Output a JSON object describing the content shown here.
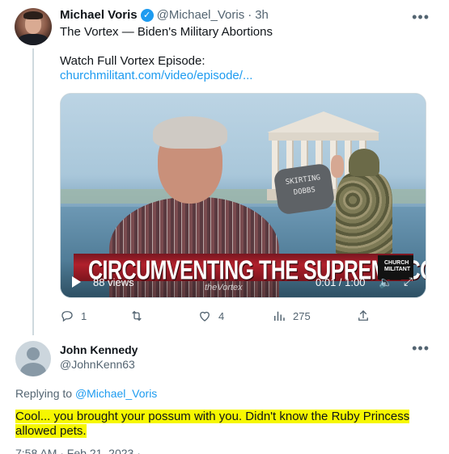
{
  "tweet": {
    "author_name": "Michael Voris",
    "author_handle": "@Michael_Voris",
    "separator": "·",
    "time": "3h",
    "text_line1": "The Vortex — Biden's Military Abortions",
    "text_line2": "Watch Full Vortex Episode:",
    "link": "churchmilitant.com/video/episode/...",
    "video": {
      "banner": "CIRCUMVENTING THE SUPREME COURT",
      "dogtag": "SKIRTING DOBBS",
      "brand": "CHURCH MILITANT",
      "show": "theVortex",
      "views": "88 views",
      "time": "0:01 / 1:00"
    },
    "actions": {
      "replies": "1",
      "retweets": "",
      "likes": "4",
      "views": "275"
    }
  },
  "reply": {
    "author_name": "John Kennedy",
    "author_handle": "@JohnKenn63",
    "replying_prefix": "Replying to",
    "replying_handle": "@Michael_Voris",
    "text_line1": "Cool... you brought your possum with you. Didn't know the Ruby Princess",
    "text_line2": "allowed pets.",
    "timestamp": "7:58 AM · Feb 21, 2023 · ..."
  },
  "icons": [
    "verified-icon",
    "more-icon",
    "play-icon",
    "volume-icon",
    "expand-icon",
    "reply-icon",
    "retweet-icon",
    "like-icon",
    "views-icon",
    "share-icon"
  ],
  "colors": {
    "accent": "#1d9bf0",
    "muted": "#536471",
    "highlight": "#f6f700",
    "banner_red": "#b0202c"
  }
}
